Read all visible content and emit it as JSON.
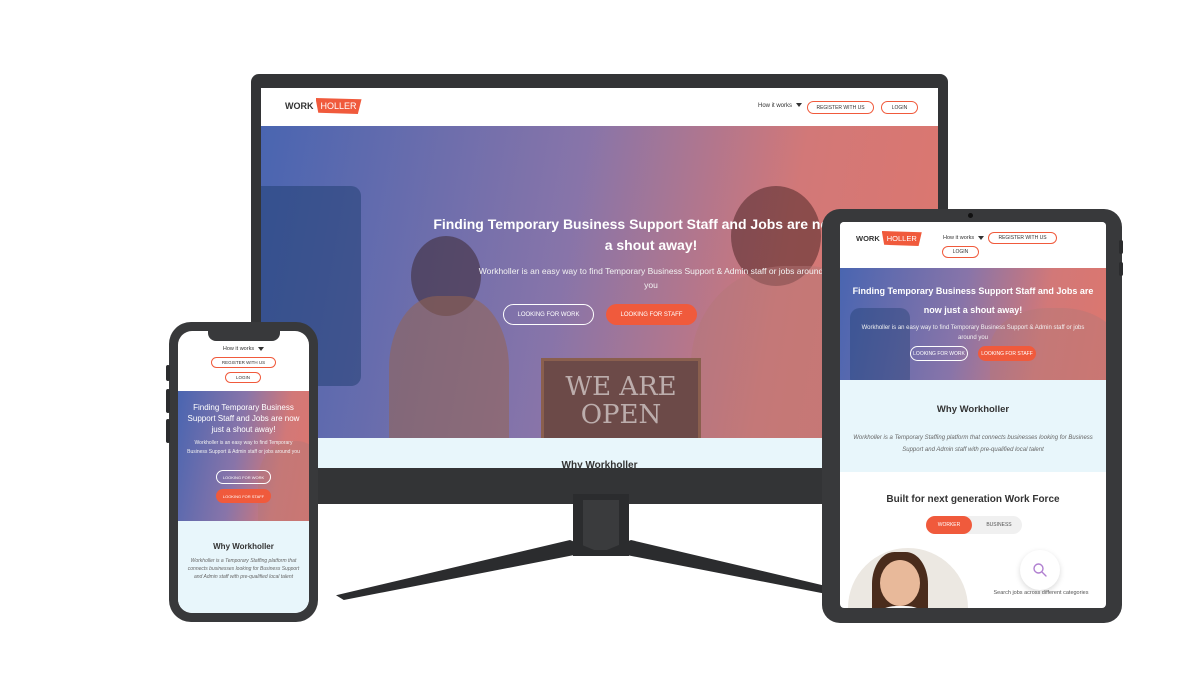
{
  "brand": {
    "word": "WORK",
    "highlight": "HOLLER",
    "accent": "#f05a3c"
  },
  "nav": {
    "how_it_works": "How it works",
    "register": "REGISTER WITH US",
    "login": "LOGIN"
  },
  "hero": {
    "title": "Finding Temporary Business Support Staff and Jobs are now just a shout away!",
    "subtitle": "Workholler is an easy way to find Temporary Business Support & Admin staff or jobs around you",
    "btn_work": "LOOKING FOR WORK",
    "btn_staff": "LOOKING FOR STAFF",
    "sign_text": "WE ARE OPEN"
  },
  "why": {
    "title": "Why Workholler",
    "description": "Workholler is a Temporary Staffing platform that connects businesses looking for Business Support and Admin staff with pre-qualified local talent"
  },
  "built": {
    "title": "Built for next generation Work Force",
    "tab_worker": "WORKER",
    "tab_business": "BUSINESS",
    "search_caption": "Search jobs across different categories",
    "search_icon": "search-icon"
  },
  "colors": {
    "hero_start": "#3a58aa",
    "hero_end": "#d76056",
    "why_bg": "#e8f6fb",
    "device": "#38393b"
  }
}
